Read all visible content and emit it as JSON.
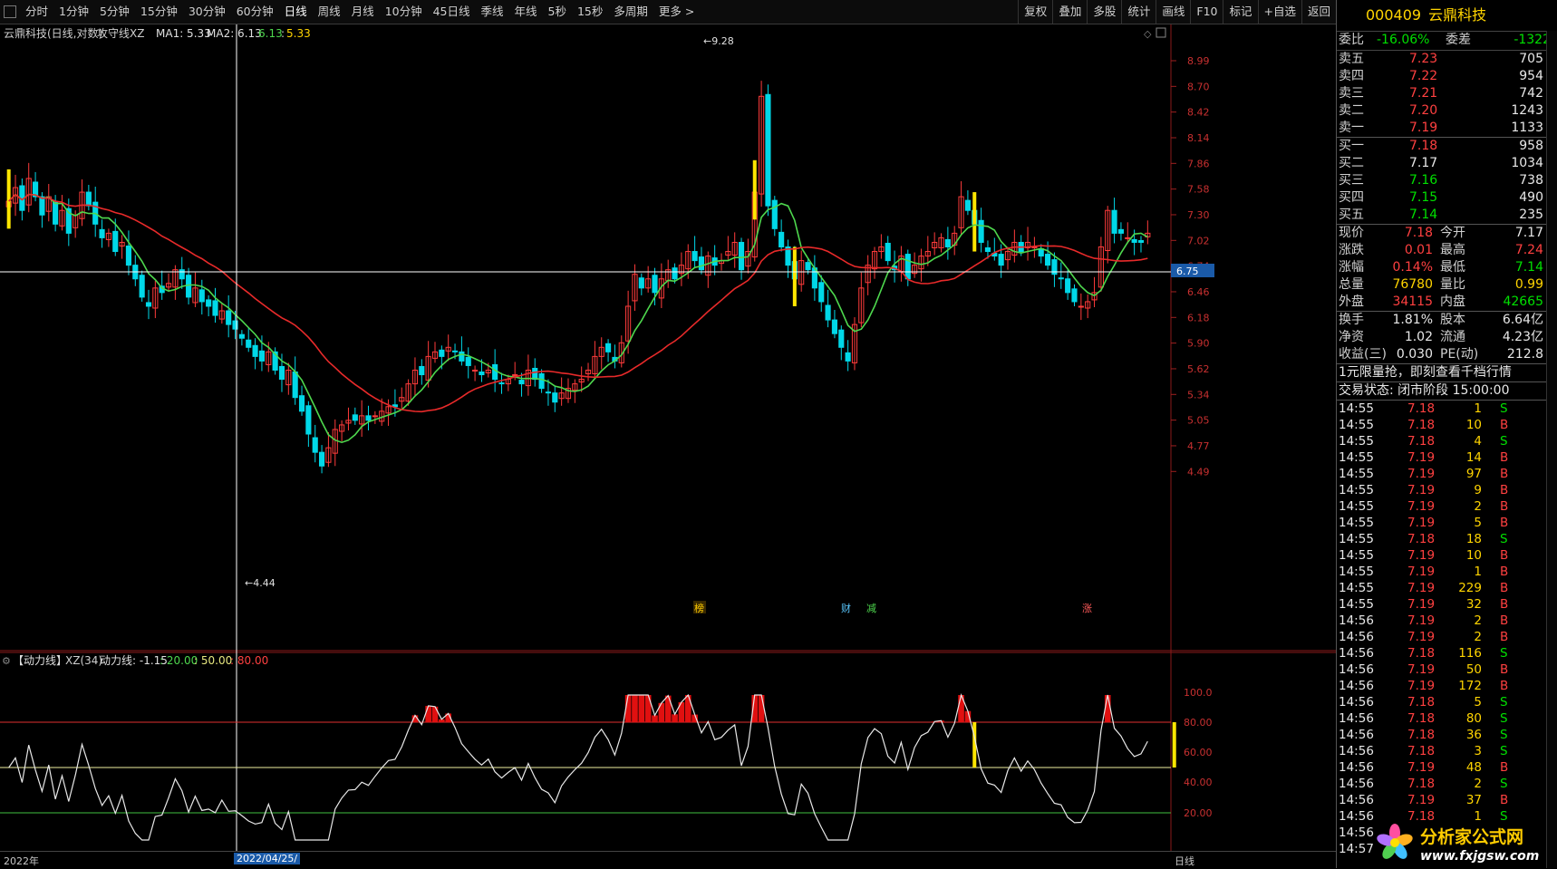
{
  "toolbar": {
    "periods": [
      "分时",
      "1分钟",
      "5分钟",
      "15分钟",
      "30分钟",
      "60分钟",
      "日线",
      "周线",
      "月线",
      "10分钟",
      "45日线",
      "季线",
      "年线",
      "5秒",
      "15秒",
      "多周期",
      "更多 >"
    ],
    "active_period": "日线",
    "tools": [
      "复权",
      "叠加",
      "多股",
      "统计",
      "画线",
      "F10",
      "标记",
      "+自选",
      "返回"
    ]
  },
  "main_chart": {
    "header": "云鼎科技(日线,对数)",
    "indicator_name": "攻守线XZ",
    "ma1_label": "MA1: 5.33",
    "ma2_label": "MA2: 6.13",
    "value_green": "6.13",
    "value_sep": ":",
    "value_yellow": "5.33",
    "y_ticks": [
      "8.99",
      "8.70",
      "8.42",
      "8.14",
      "7.86",
      "7.58",
      "7.30",
      "7.02",
      "6.74",
      "6.46",
      "6.18",
      "5.90",
      "5.62",
      "5.34",
      "5.05",
      "4.77",
      "4.49"
    ],
    "crosshair_price": "6.75",
    "high_mark": "9.28",
    "low_mark": "4.44",
    "event_markers": [
      "榜",
      "财",
      "减",
      "涨"
    ],
    "colors": {
      "up": "#ff3b3b",
      "down": "#00d8e8",
      "ma_red": "#e82a2a",
      "ma_green": "#4ed84e",
      "marker": "#ffe600"
    }
  },
  "sub_chart": {
    "title": "【动力线】",
    "formula": "XZ(34)",
    "line_label": "动力线: -1.15",
    "value_20": ": 20.00",
    "value_50": ": 50.00",
    "value_80": ": 80.00",
    "y_ticks": [
      "100.0",
      "80.00",
      "60.00",
      "40.00",
      "20.00"
    ]
  },
  "date_axis": {
    "year_label": "2022年",
    "cursor_date": "2022/04/25/",
    "right_label": "日线"
  },
  "panel": {
    "code": "000409",
    "name": "云鼎科技",
    "ratio_label": "委比",
    "ratio_value": "-16.06%",
    "diff_label": "委差",
    "diff_value": "-1322",
    "asks": [
      {
        "label": "卖五",
        "price": "7.23",
        "vol": "705"
      },
      {
        "label": "卖四",
        "price": "7.22",
        "vol": "954"
      },
      {
        "label": "卖三",
        "price": "7.21",
        "vol": "742"
      },
      {
        "label": "卖二",
        "price": "7.20",
        "vol": "1243"
      },
      {
        "label": "卖一",
        "price": "7.19",
        "vol": "1133"
      }
    ],
    "bids": [
      {
        "label": "买一",
        "price": "7.18",
        "vol": "958"
      },
      {
        "label": "买二",
        "price": "7.17",
        "vol": "1034"
      },
      {
        "label": "买三",
        "price": "7.16",
        "vol": "738"
      },
      {
        "label": "买四",
        "price": "7.15",
        "vol": "490"
      },
      {
        "label": "买五",
        "price": "7.14",
        "vol": "235"
      }
    ],
    "quote": [
      {
        "l1": "现价",
        "v1": "7.18",
        "l2": "今开",
        "v2": "7.17"
      },
      {
        "l1": "涨跌",
        "v1": "0.01",
        "l2": "最高",
        "v2": "7.24"
      },
      {
        "l1": "涨幅",
        "v1": "0.14%",
        "l2": "最低",
        "v2": "7.14"
      },
      {
        "l1": "总量",
        "v1": "76780",
        "l2": "量比",
        "v2": "0.99"
      },
      {
        "l1": "外盘",
        "v1": "34115",
        "l2": "内盘",
        "v2": "42665"
      }
    ],
    "finance": [
      {
        "l1": "换手",
        "v1": "1.81%",
        "l2": "股本",
        "v2": "6.64亿"
      },
      {
        "l1": "净资",
        "v1": "1.02",
        "l2": "流通",
        "v2": "4.23亿"
      },
      {
        "l1": "收益(三)",
        "v1": "0.030",
        "l2": "PE(动)",
        "v2": "212.8"
      }
    ],
    "promo": "1元限量抢，即刻查看千档行情",
    "status": "交易状态: 闭市阶段 15:00:00",
    "ticks": [
      {
        "t": "14:55",
        "p": "7.18",
        "v": "1",
        "d": "S"
      },
      {
        "t": "14:55",
        "p": "7.18",
        "v": "10",
        "d": "B"
      },
      {
        "t": "14:55",
        "p": "7.18",
        "v": "4",
        "d": "S"
      },
      {
        "t": "14:55",
        "p": "7.19",
        "v": "14",
        "d": "B"
      },
      {
        "t": "14:55",
        "p": "7.19",
        "v": "97",
        "d": "B"
      },
      {
        "t": "14:55",
        "p": "7.19",
        "v": "9",
        "d": "B"
      },
      {
        "t": "14:55",
        "p": "7.19",
        "v": "2",
        "d": "B"
      },
      {
        "t": "14:55",
        "p": "7.19",
        "v": "5",
        "d": "B"
      },
      {
        "t": "14:55",
        "p": "7.18",
        "v": "18",
        "d": "S"
      },
      {
        "t": "14:55",
        "p": "7.19",
        "v": "10",
        "d": "B"
      },
      {
        "t": "14:55",
        "p": "7.19",
        "v": "1",
        "d": "B"
      },
      {
        "t": "14:55",
        "p": "7.19",
        "v": "229",
        "d": "B"
      },
      {
        "t": "14:55",
        "p": "7.19",
        "v": "32",
        "d": "B"
      },
      {
        "t": "14:56",
        "p": "7.19",
        "v": "2",
        "d": "B"
      },
      {
        "t": "14:56",
        "p": "7.19",
        "v": "2",
        "d": "B"
      },
      {
        "t": "14:56",
        "p": "7.18",
        "v": "116",
        "d": "S"
      },
      {
        "t": "14:56",
        "p": "7.19",
        "v": "50",
        "d": "B"
      },
      {
        "t": "14:56",
        "p": "7.19",
        "v": "172",
        "d": "B"
      },
      {
        "t": "14:56",
        "p": "7.18",
        "v": "5",
        "d": "S"
      },
      {
        "t": "14:56",
        "p": "7.18",
        "v": "80",
        "d": "S"
      },
      {
        "t": "14:56",
        "p": "7.18",
        "v": "36",
        "d": "S"
      },
      {
        "t": "14:56",
        "p": "7.18",
        "v": "3",
        "d": "S"
      },
      {
        "t": "14:56",
        "p": "7.19",
        "v": "48",
        "d": "B"
      },
      {
        "t": "14:56",
        "p": "7.18",
        "v": "2",
        "d": "S"
      },
      {
        "t": "14:56",
        "p": "7.19",
        "v": "37",
        "d": "B"
      },
      {
        "t": "14:56",
        "p": "7.18",
        "v": "1",
        "d": "S"
      },
      {
        "t": "14:56",
        "p": "",
        "v": "",
        "d": ""
      },
      {
        "t": "14:57",
        "p": "",
        "v": "",
        "d": ""
      }
    ],
    "logo_text": "分析家公式网",
    "logo_url": "www.fxjgsw.com"
  }
}
